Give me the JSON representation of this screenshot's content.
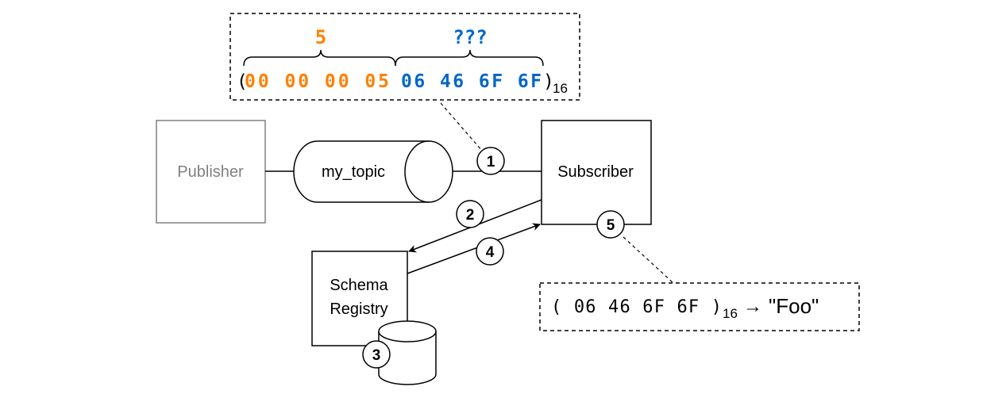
{
  "colors": {
    "orange": "#FF8000",
    "blue": "#0066CC",
    "gray": "#808080",
    "line": "#000000"
  },
  "top_callout": {
    "length_label": "5",
    "payload_label": "???",
    "open_paren": "(",
    "length_bytes": "00 00 00 05",
    "payload_bytes": "06 46 6F 6F",
    "close_paren": ")",
    "base": "16"
  },
  "nodes": {
    "publisher": "Publisher",
    "topic": "my_topic",
    "subscriber": "Subscriber",
    "registry_line1": "Schema",
    "registry_line2": "Registry"
  },
  "steps": [
    "1",
    "2",
    "3",
    "4",
    "5"
  ],
  "bottom_callout": {
    "bytes": "( 06 46 6F 6F )",
    "base": "16",
    "arrow": "→",
    "result": "\"Foo\""
  }
}
